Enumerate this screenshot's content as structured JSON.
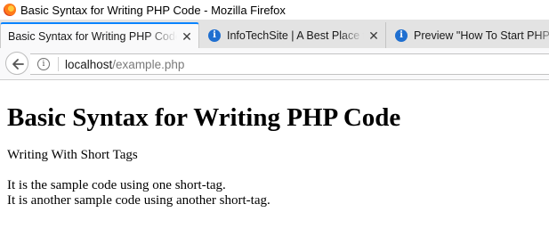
{
  "window": {
    "title": "Basic Syntax for Writing PHP Code - Mozilla Firefox"
  },
  "tabs": [
    {
      "label": "Basic Syntax for Writing PHP Code",
      "icon": "firefox-icon",
      "active": true
    },
    {
      "label": "InfoTechSite | A Best Place for",
      "icon": "info-icon",
      "active": false
    },
    {
      "label": "Preview \"How To Start PHP",
      "icon": "info-icon",
      "active": false
    }
  ],
  "navbar": {
    "url_host": "localhost",
    "url_path": "/example.php"
  },
  "page": {
    "heading": "Basic Syntax for Writing PHP Code",
    "paragraph1": "Writing With Short Tags",
    "line1": "It is the sample code using one short-tag.",
    "line2": "It is another sample code using another short-tag."
  },
  "colors": {
    "active_tab_accent": "#0a84ff",
    "tab_strip": "#e3e3e3",
    "toolbar": "#f9f9fa"
  }
}
